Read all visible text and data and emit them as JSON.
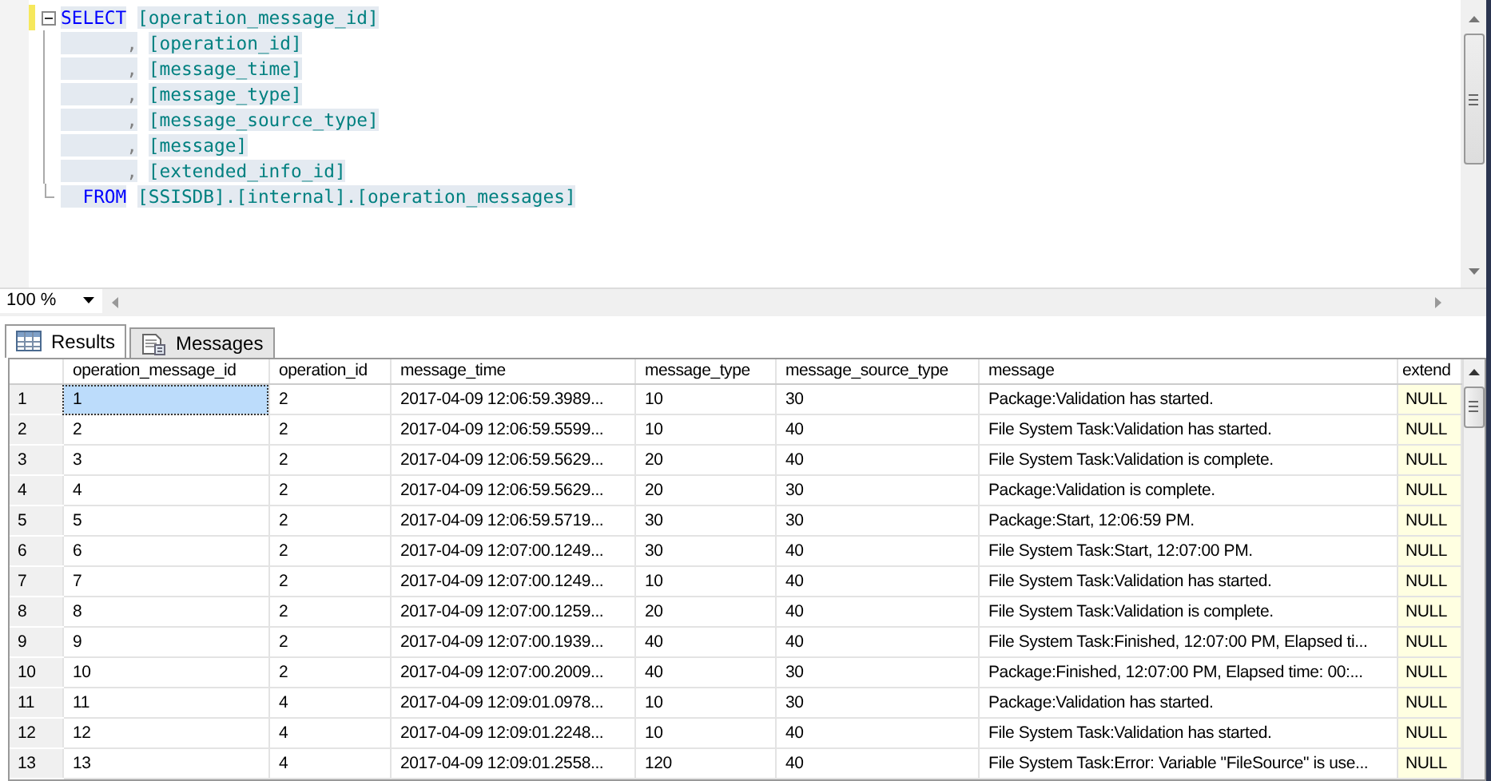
{
  "editor": {
    "lines": [
      {
        "kind": "keyword",
        "lead": "SELECT",
        "text": "[operation_message_id]",
        "changed": true
      },
      {
        "kind": "comma",
        "lead": "      ,",
        "text": "[operation_id]",
        "changed": false
      },
      {
        "kind": "comma",
        "lead": "      ,",
        "text": "[message_time]",
        "changed": false
      },
      {
        "kind": "comma",
        "lead": "      ,",
        "text": "[message_type]",
        "changed": false
      },
      {
        "kind": "comma",
        "lead": "      ,",
        "text": "[message_source_type]",
        "changed": false
      },
      {
        "kind": "comma",
        "lead": "      ,",
        "text": "[message]",
        "changed": false
      },
      {
        "kind": "comma",
        "lead": "      ,",
        "text": "[extended_info_id]",
        "changed": false
      },
      {
        "kind": "keyword",
        "lead": "  FROM",
        "text": "[SSISDB].[internal].[operation_messages]",
        "changed": false
      }
    ]
  },
  "zoom": {
    "value": "100 %"
  },
  "tabs": [
    {
      "label": "Results",
      "selected": true
    },
    {
      "label": "Messages",
      "selected": false
    }
  ],
  "grid": {
    "columns": [
      {
        "label": "operation_message_id",
        "kind": "text"
      },
      {
        "label": "operation_id",
        "kind": "text"
      },
      {
        "label": "message_time",
        "kind": "text"
      },
      {
        "label": "message_type",
        "kind": "text"
      },
      {
        "label": "message_source_type",
        "kind": "text"
      },
      {
        "label": "message",
        "kind": "text"
      },
      {
        "label": "extend",
        "kind": "null"
      }
    ],
    "rows": [
      {
        "number": "1",
        "selected": true,
        "cells": [
          "1",
          "2",
          "2017-04-09 12:06:59.3989...",
          "10",
          "30",
          "Package:Validation has started.",
          "NULL"
        ]
      },
      {
        "number": "2",
        "selected": false,
        "cells": [
          "2",
          "2",
          "2017-04-09 12:06:59.5599...",
          "10",
          "40",
          "File System Task:Validation has started.",
          "NULL"
        ]
      },
      {
        "number": "3",
        "selected": false,
        "cells": [
          "3",
          "2",
          "2017-04-09 12:06:59.5629...",
          "20",
          "40",
          "File System Task:Validation is complete.",
          "NULL"
        ]
      },
      {
        "number": "4",
        "selected": false,
        "cells": [
          "4",
          "2",
          "2017-04-09 12:06:59.5629...",
          "20",
          "30",
          "Package:Validation is complete.",
          "NULL"
        ]
      },
      {
        "number": "5",
        "selected": false,
        "cells": [
          "5",
          "2",
          "2017-04-09 12:06:59.5719...",
          "30",
          "30",
          "Package:Start, 12:06:59 PM.",
          "NULL"
        ]
      },
      {
        "number": "6",
        "selected": false,
        "cells": [
          "6",
          "2",
          "2017-04-09 12:07:00.1249...",
          "30",
          "40",
          "File System Task:Start, 12:07:00 PM.",
          "NULL"
        ]
      },
      {
        "number": "7",
        "selected": false,
        "cells": [
          "7",
          "2",
          "2017-04-09 12:07:00.1249...",
          "10",
          "40",
          "File System Task:Validation has started.",
          "NULL"
        ]
      },
      {
        "number": "8",
        "selected": false,
        "cells": [
          "8",
          "2",
          "2017-04-09 12:07:00.1259...",
          "20",
          "40",
          "File System Task:Validation is complete.",
          "NULL"
        ]
      },
      {
        "number": "9",
        "selected": false,
        "cells": [
          "9",
          "2",
          "2017-04-09 12:07:00.1939...",
          "40",
          "40",
          "File System Task:Finished, 12:07:00 PM, Elapsed ti...",
          "NULL"
        ]
      },
      {
        "number": "10",
        "selected": false,
        "cells": [
          "10",
          "2",
          "2017-04-09 12:07:00.2009...",
          "40",
          "30",
          "Package:Finished, 12:07:00 PM, Elapsed time: 00:...",
          "NULL"
        ]
      },
      {
        "number": "11",
        "selected": false,
        "cells": [
          "11",
          "4",
          "2017-04-09 12:09:01.0978...",
          "10",
          "30",
          "Package:Validation has started.",
          "NULL"
        ]
      },
      {
        "number": "12",
        "selected": false,
        "cells": [
          "12",
          "4",
          "2017-04-09 12:09:01.2248...",
          "10",
          "40",
          "File System Task:Validation has started.",
          "NULL"
        ]
      },
      {
        "number": "13",
        "selected": false,
        "cells": [
          "13",
          "4",
          "2017-04-09 12:09:01.2558...",
          "120",
          "40",
          "File System Task:Error: Variable \"FileSource\" is use...",
          "NULL"
        ]
      }
    ]
  }
}
